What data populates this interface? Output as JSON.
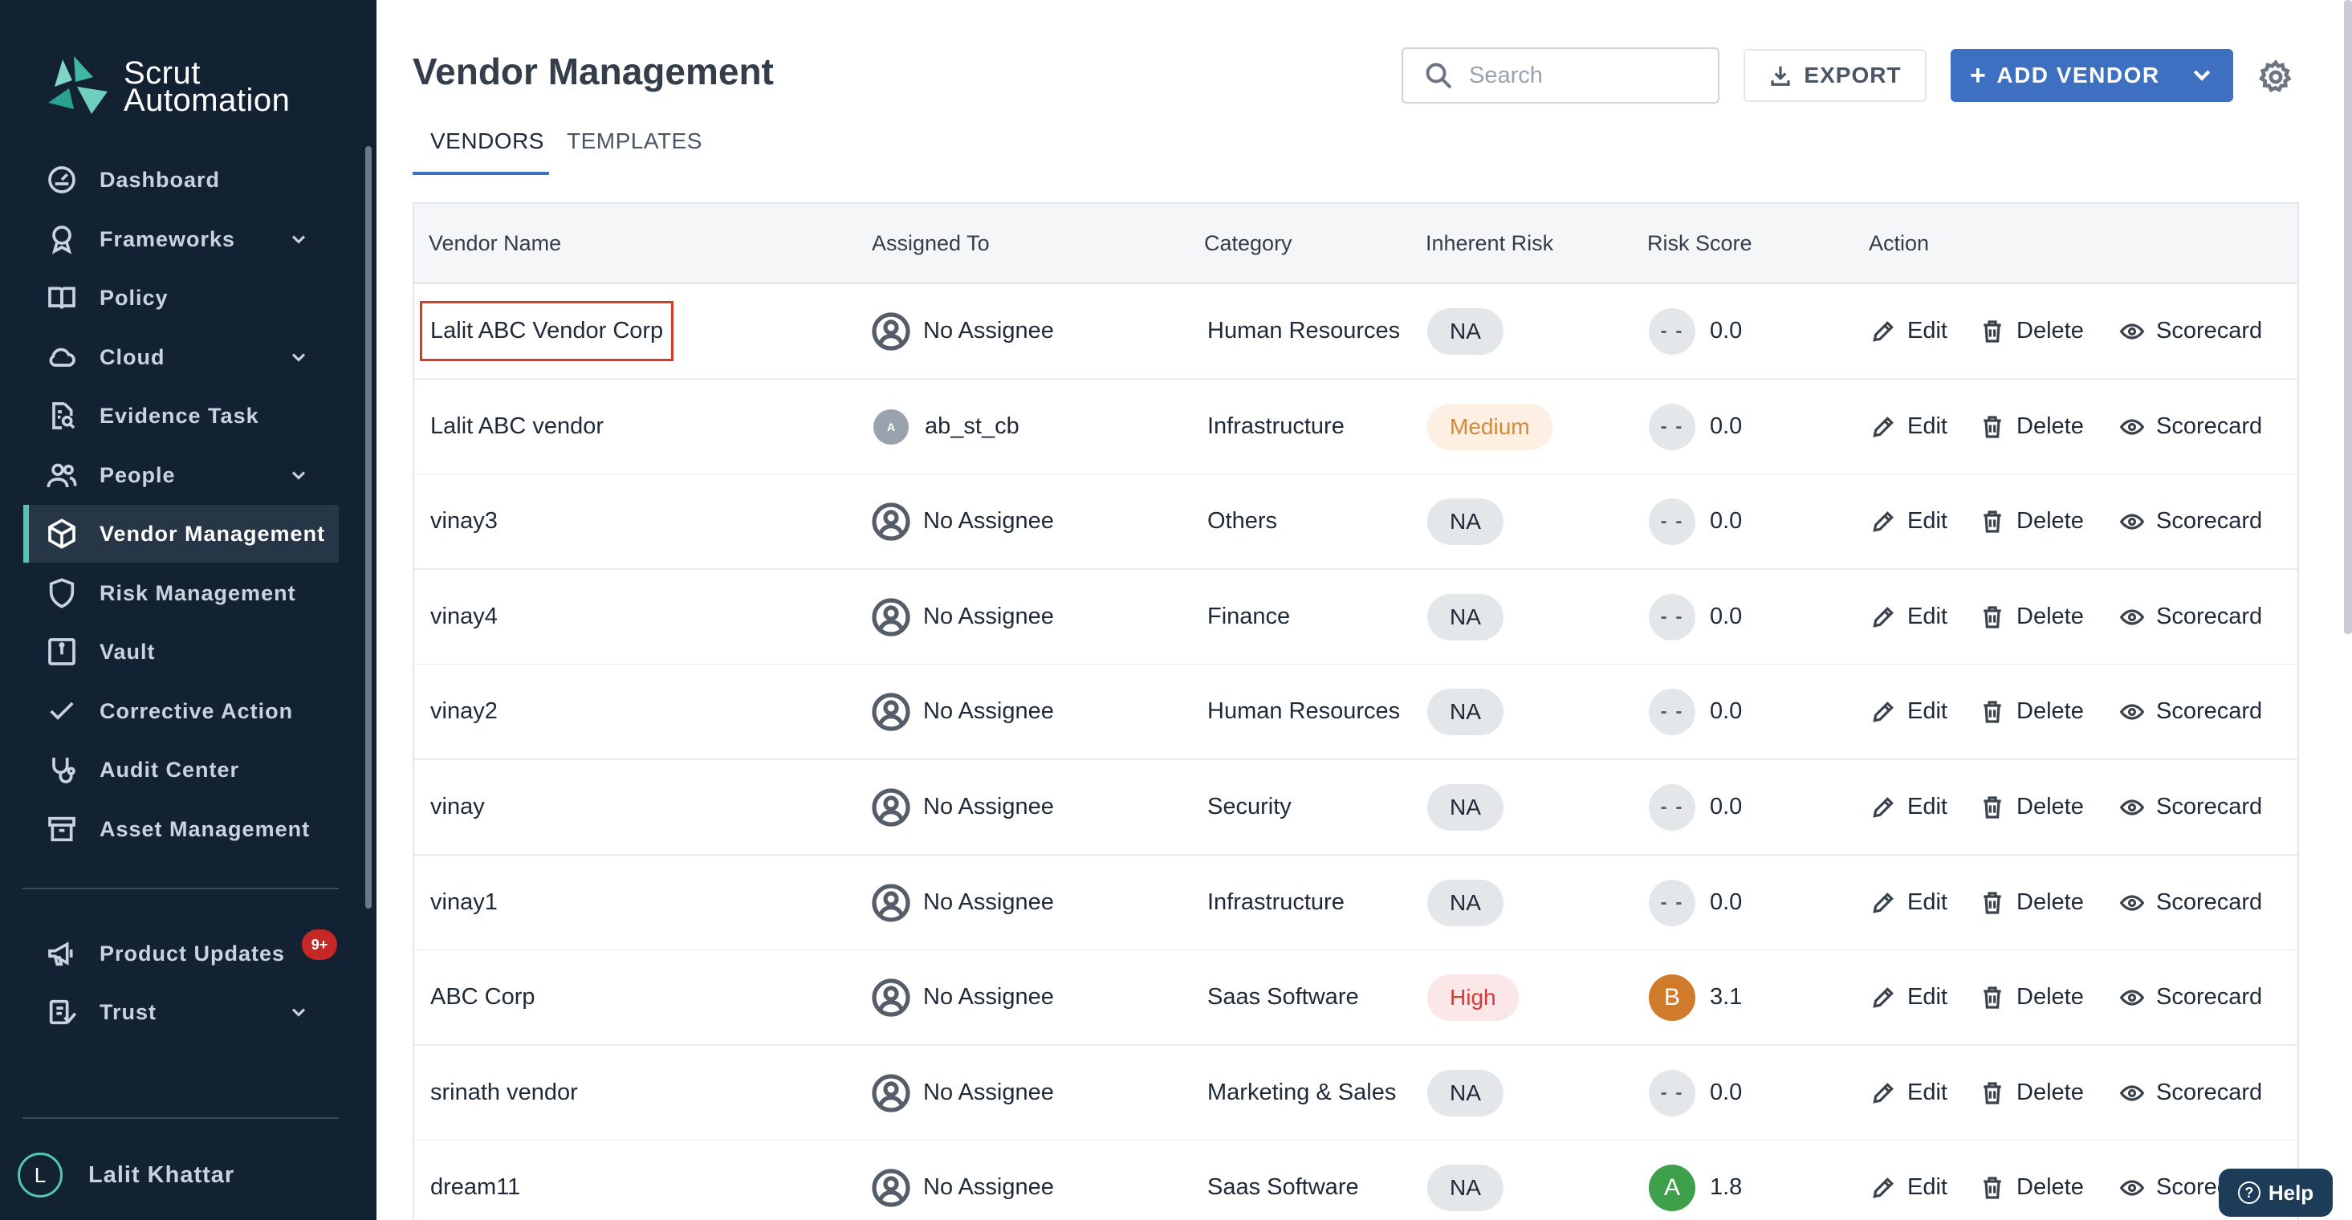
{
  "brand": {
    "name_line1": "Scrut",
    "name_line2": "Automation",
    "accent": "#53c5b3",
    "sidebar_bg": "#132233"
  },
  "sidebar": {
    "items": [
      {
        "label": "Dashboard",
        "icon": "dashboard-icon",
        "expandable": false,
        "active": false
      },
      {
        "label": "Frameworks",
        "icon": "award-icon",
        "expandable": true,
        "active": false
      },
      {
        "label": "Policy",
        "icon": "book-icon",
        "expandable": false,
        "active": false
      },
      {
        "label": "Cloud",
        "icon": "cloud-icon",
        "expandable": true,
        "active": false
      },
      {
        "label": "Evidence Task",
        "icon": "file-search-icon",
        "expandable": false,
        "active": false
      },
      {
        "label": "People",
        "icon": "users-icon",
        "expandable": true,
        "active": false
      },
      {
        "label": "Vendor Management",
        "icon": "box-icon",
        "expandable": false,
        "active": true
      },
      {
        "label": "Risk Management",
        "icon": "shield-icon",
        "expandable": false,
        "active": false
      },
      {
        "label": "Vault",
        "icon": "vault-icon",
        "expandable": false,
        "active": false
      },
      {
        "label": "Corrective Action",
        "icon": "check-icon",
        "expandable": false,
        "active": false
      },
      {
        "label": "Audit Center",
        "icon": "stethoscope-icon",
        "expandable": false,
        "active": false
      },
      {
        "label": "Asset Management",
        "icon": "archive-icon",
        "expandable": false,
        "active": false
      }
    ],
    "bottom_items": [
      {
        "label": "Product Updates",
        "icon": "megaphone-icon",
        "badge": "9+"
      },
      {
        "label": "Trust",
        "icon": "trust-icon",
        "expandable": true
      }
    ],
    "user": {
      "initial": "L",
      "name": "Lalit Khattar"
    }
  },
  "header": {
    "title": "Vendor Management",
    "search_placeholder": "Search",
    "export_label": "EXPORT",
    "add_vendor_label": "ADD VENDOR",
    "primary_color": "#3d70c0"
  },
  "tabs": [
    {
      "label": "VENDORS",
      "active": true
    },
    {
      "label": "TEMPLATES",
      "active": false
    }
  ],
  "table": {
    "columns": [
      "Vendor Name",
      "Assigned To",
      "Category",
      "Inherent Risk",
      "Risk Score",
      "Action"
    ],
    "actions": {
      "edit": "Edit",
      "delete": "Delete",
      "scorecard": "Scorecard"
    },
    "rows": [
      {
        "vendor": "Lalit ABC Vendor Corp",
        "assignee": "No Assignee",
        "assignee_type": "none",
        "category": "Human Resources",
        "risk": "NA",
        "risk_level": "na",
        "score_badge": "- -",
        "score": "0.0"
      },
      {
        "vendor": "Lalit ABC vendor",
        "assignee": "ab_st_cb",
        "assignee_type": "avatar",
        "assignee_initial": "A",
        "category": "Infrastructure",
        "risk": "Medium",
        "risk_level": "medium",
        "score_badge": "- -",
        "score": "0.0"
      },
      {
        "vendor": "vinay3",
        "assignee": "No Assignee",
        "assignee_type": "none",
        "category": "Others",
        "risk": "NA",
        "risk_level": "na",
        "score_badge": "- -",
        "score": "0.0"
      },
      {
        "vendor": "vinay4",
        "assignee": "No Assignee",
        "assignee_type": "none",
        "category": "Finance",
        "risk": "NA",
        "risk_level": "na",
        "score_badge": "- -",
        "score": "0.0"
      },
      {
        "vendor": "vinay2",
        "assignee": "No Assignee",
        "assignee_type": "none",
        "category": "Human Resources",
        "risk": "NA",
        "risk_level": "na",
        "score_badge": "- -",
        "score": "0.0"
      },
      {
        "vendor": "vinay",
        "assignee": "No Assignee",
        "assignee_type": "none",
        "category": "Security",
        "risk": "NA",
        "risk_level": "na",
        "score_badge": "- -",
        "score": "0.0"
      },
      {
        "vendor": "vinay1",
        "assignee": "No Assignee",
        "assignee_type": "none",
        "category": "Infrastructure",
        "risk": "NA",
        "risk_level": "na",
        "score_badge": "- -",
        "score": "0.0"
      },
      {
        "vendor": "ABC Corp",
        "assignee": "No Assignee",
        "assignee_type": "none",
        "category": "Saas Software",
        "risk": "High",
        "risk_level": "high",
        "score_badge": "B",
        "score": "3.1"
      },
      {
        "vendor": "srinath vendor",
        "assignee": "No Assignee",
        "assignee_type": "none",
        "category": "Marketing & Sales",
        "risk": "NA",
        "risk_level": "na",
        "score_badge": "- -",
        "score": "0.0"
      },
      {
        "vendor": "dream11",
        "assignee": "No Assignee",
        "assignee_type": "none",
        "category": "Saas Software",
        "risk": "NA",
        "risk_level": "na",
        "score_badge": "A",
        "score": "1.8"
      }
    ]
  },
  "help": {
    "label": "Help"
  }
}
